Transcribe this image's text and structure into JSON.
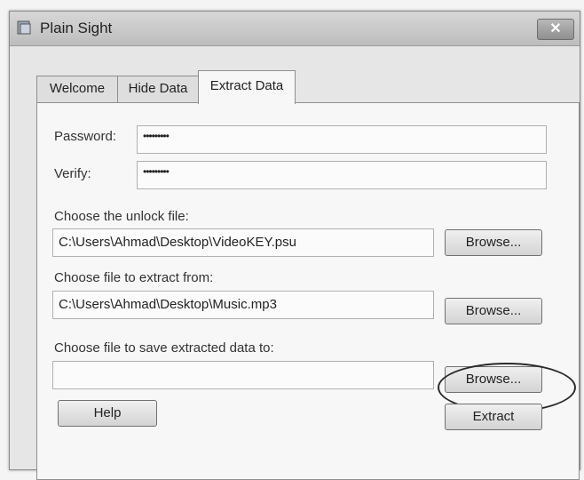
{
  "window": {
    "title": "Plain Sight",
    "close_label": "✕"
  },
  "tabs": [
    {
      "label": "Welcome",
      "active": false
    },
    {
      "label": "Hide Data",
      "active": false
    },
    {
      "label": "Extract Data",
      "active": true
    }
  ],
  "form": {
    "password_label": "Password:",
    "password_value": "•••••••••",
    "verify_label": "Verify:",
    "verify_value": "•••••••••",
    "unlock_label": "Choose the unlock file:",
    "unlock_value": "C:\\Users\\Ahmad\\Desktop\\VideoKEY.psu",
    "extract_from_label": "Choose file to extract from:",
    "extract_from_value": "C:\\Users\\Ahmad\\Desktop\\Music.mp3",
    "save_to_label": "Choose file to save extracted data to:",
    "save_to_value": ""
  },
  "buttons": {
    "browse_label": "Browse...",
    "help_label": "Help",
    "extract_label": "Extract"
  }
}
